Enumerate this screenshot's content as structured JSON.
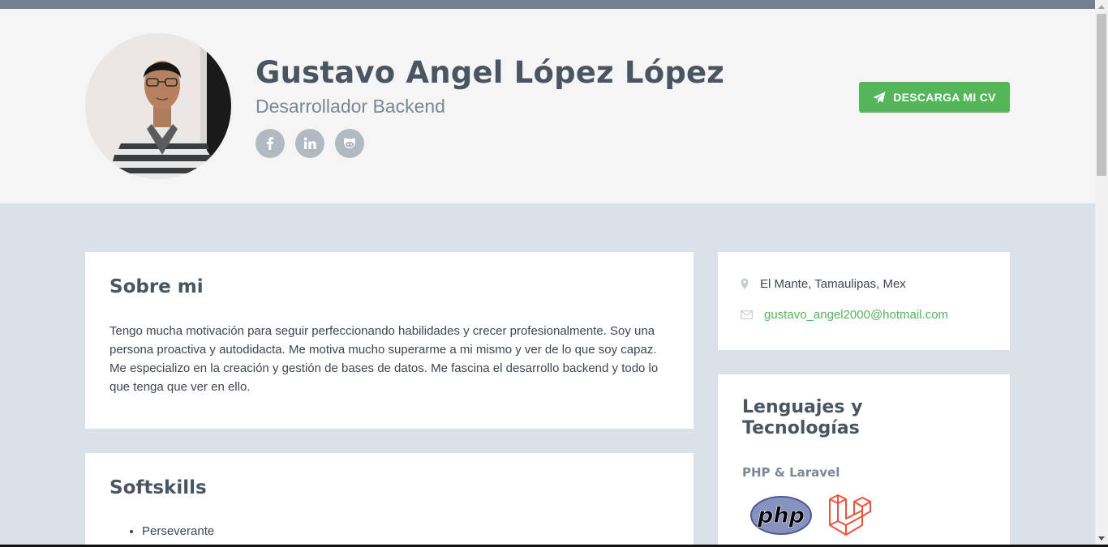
{
  "profile": {
    "name": "Gustavo Angel López López",
    "tagline": "Desarrollador Backend",
    "cv_button": "DESCARGA MI CV"
  },
  "socials": [
    {
      "icon": "facebook-icon"
    },
    {
      "icon": "linkedin-icon"
    },
    {
      "icon": "github-icon"
    }
  ],
  "about": {
    "title": "Sobre mi",
    "text": "Tengo mucha motivación para seguir perfeccionando habilidades y crecer profesionalmente. Soy una persona proactiva y autodidacta. Me motiva mucho superarme a mi mismo y ver de lo que soy capaz. Me especializo en la creación y gestión de bases de datos. Me fascina el desarrollo backend y todo lo que tenga que ver en ello."
  },
  "softskills": {
    "title": "Softskills",
    "items": [
      "Perseverante"
    ]
  },
  "contact": {
    "location": "El Mante, Tamaulipas, Mex",
    "email": "gustavo_angel2000@hotmail.com"
  },
  "languages": {
    "title": "Lenguajes y Tecnologías",
    "group": "PHP & Laravel",
    "logos": [
      "php-logo",
      "laravel-logo"
    ],
    "php_text": "php"
  },
  "colors": {
    "accent": "#54b659",
    "header_bg": "#f5f5f5",
    "page_bg": "#dbe1e8",
    "heading": "#4b5562"
  }
}
